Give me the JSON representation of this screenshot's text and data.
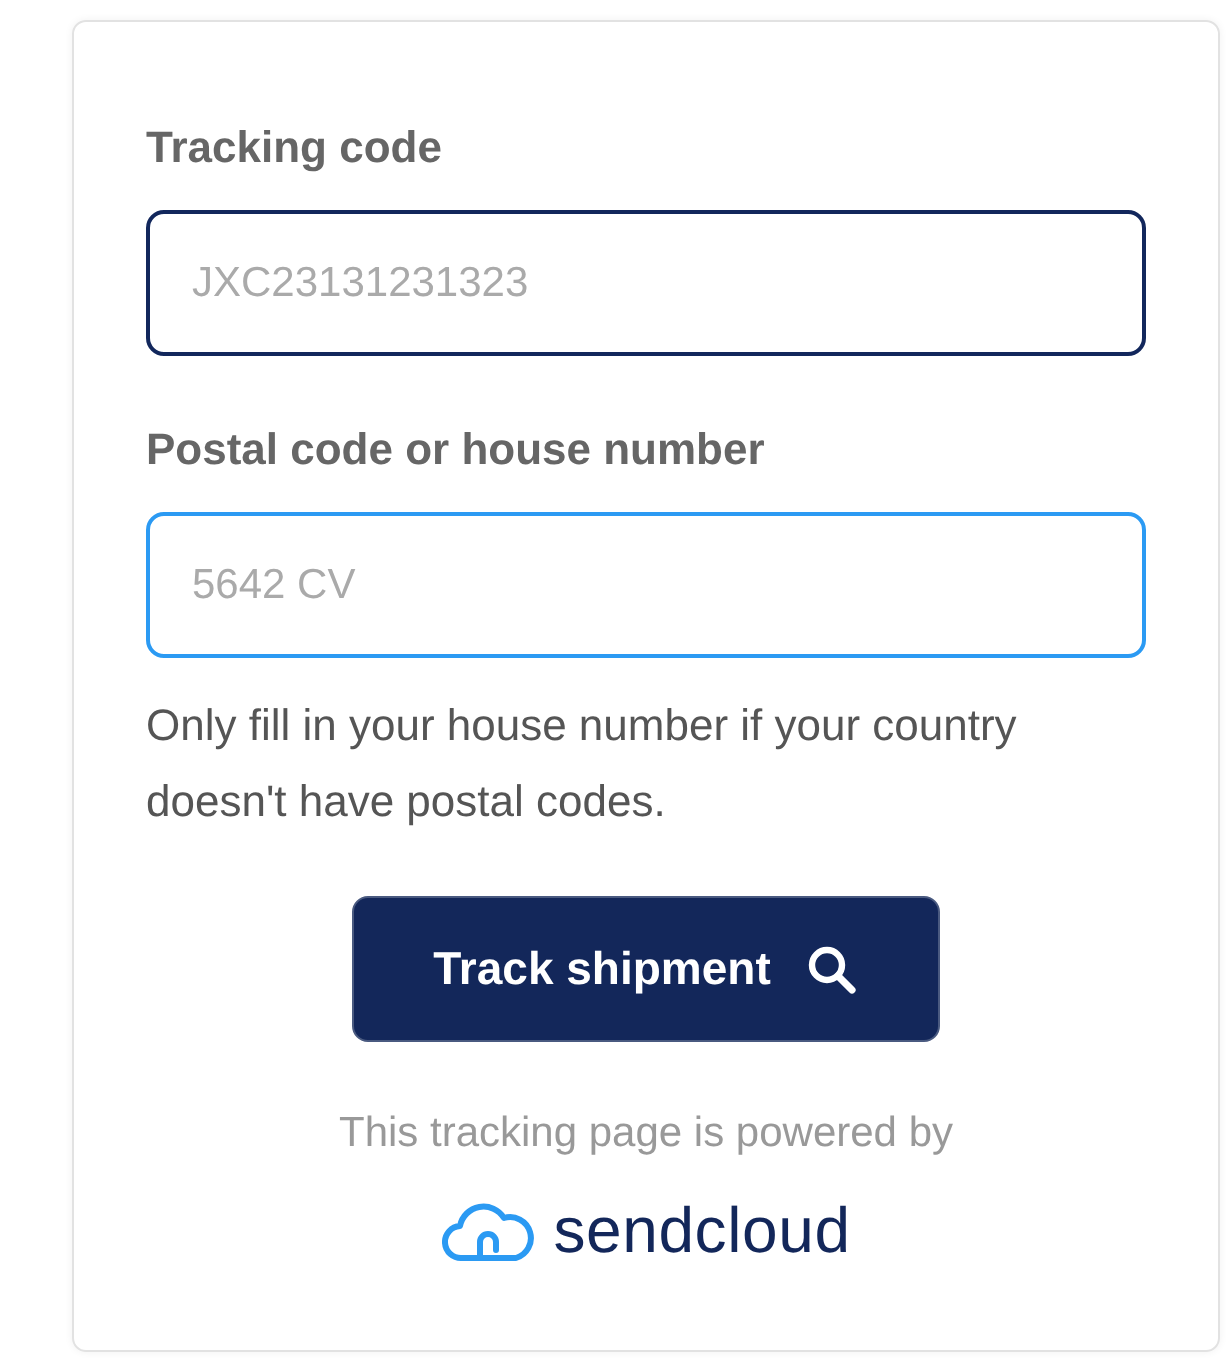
{
  "form": {
    "fields": [
      {
        "label": "Tracking code",
        "placeholder": "JXC23131231323",
        "focused": false
      },
      {
        "label": "Postal code or house number",
        "placeholder": "5642 CV",
        "focused": true
      }
    ],
    "hint": "Only fill in your house number if your country doesn't have postal codes.",
    "button": {
      "label": "Track shipment"
    }
  },
  "footer": {
    "powered_by": "This tracking page is powered by",
    "logo": "sendcloud"
  }
}
